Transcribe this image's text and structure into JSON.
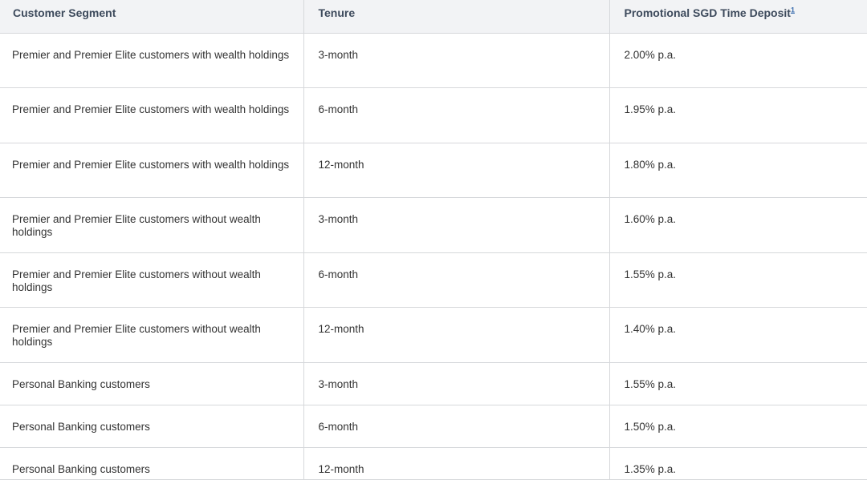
{
  "table": {
    "headers": {
      "segment": "Customer Segment",
      "tenure": "Tenure",
      "rate": "Promotional SGD Time Deposit",
      "rate_footnote": "1"
    },
    "rows": [
      {
        "segment": "Premier and Premier Elite customers with wealth holdings",
        "tenure": "3-month",
        "rate": "2.00% p.a."
      },
      {
        "segment": "Premier and Premier Elite customers with wealth holdings",
        "tenure": "6-month",
        "rate": "1.95% p.a."
      },
      {
        "segment": "Premier and Premier Elite customers with wealth holdings",
        "tenure": "12-month",
        "rate": "1.80% p.a."
      },
      {
        "segment": "Premier and Premier Elite customers without wealth holdings",
        "tenure": "3-month",
        "rate": "1.60% p.a."
      },
      {
        "segment": "Premier and Premier Elite customers without wealth holdings",
        "tenure": "6-month",
        "rate": "1.55% p.a."
      },
      {
        "segment": "Premier and Premier Elite customers without wealth holdings",
        "tenure": "12-month",
        "rate": "1.40% p.a."
      },
      {
        "segment": "Personal Banking customers",
        "tenure": "3-month",
        "rate": "1.55% p.a."
      },
      {
        "segment": "Personal Banking customers",
        "tenure": "6-month",
        "rate": "1.50% p.a."
      },
      {
        "segment": "Personal Banking customers",
        "tenure": "12-month",
        "rate": "1.35% p.a."
      }
    ]
  },
  "colors": {
    "header_bg": "#f2f3f5",
    "header_text": "#3d4a5c",
    "border": "#d6d8db",
    "body_text": "#333333",
    "footnote_link": "#3d6fb0"
  }
}
